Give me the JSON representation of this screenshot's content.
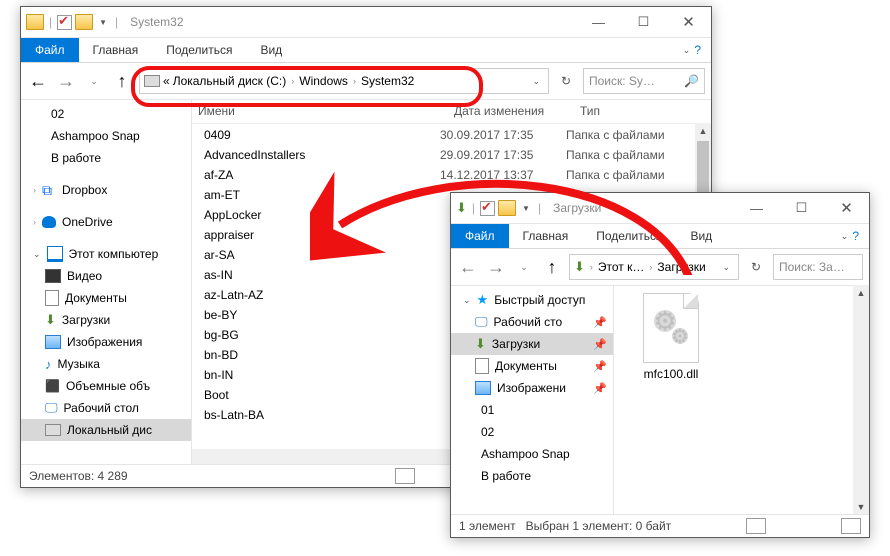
{
  "win1": {
    "title": "System32",
    "tabs": {
      "file": "Файл",
      "home": "Главная",
      "share": "Поделиться",
      "view": "Вид"
    },
    "breadcrumb": {
      "prefix": "«",
      "p1": "Локальный диск (C:)",
      "p2": "Windows",
      "p3": "System32"
    },
    "search_placeholder": "Поиск: Sy…",
    "columns": {
      "name": "Имени",
      "date": "Дата изменения",
      "type": "Тип"
    },
    "nav": {
      "i0": "02",
      "i1": "Ashampoo Snap",
      "i2": "В работе",
      "i3": "Dropbox",
      "i4": "OneDrive",
      "i5": "Этот компьютер",
      "i6": "Видео",
      "i7": "Документы",
      "i8": "Загрузки",
      "i9": "Изображения",
      "i10": "Музыка",
      "i11": "Объемные объ",
      "i12": "Рабочий стол",
      "i13": "Локальный дис"
    },
    "files": [
      {
        "name": "0409",
        "date": "30.09.2017 17:35",
        "type": "Папка с файлами"
      },
      {
        "name": "AdvancedInstallers",
        "date": "29.09.2017 17:35",
        "type": "Папка с файлами"
      },
      {
        "name": "af-ZA",
        "date": "14.12.2017 13:37",
        "type": "Папка с файлами"
      },
      {
        "name": "am-ET",
        "date": "",
        "type": ""
      },
      {
        "name": "AppLocker",
        "date": "",
        "type": ""
      },
      {
        "name": "appraiser",
        "date": "",
        "type": ""
      },
      {
        "name": "ar-SA",
        "date": "",
        "type": ""
      },
      {
        "name": "as-IN",
        "date": "",
        "type": ""
      },
      {
        "name": "az-Latn-AZ",
        "date": "",
        "type": ""
      },
      {
        "name": "be-BY",
        "date": "",
        "type": ""
      },
      {
        "name": "bg-BG",
        "date": "",
        "type": ""
      },
      {
        "name": "bn-BD",
        "date": "",
        "type": ""
      },
      {
        "name": "bn-IN",
        "date": "",
        "type": ""
      },
      {
        "name": "Boot",
        "date": "",
        "type": ""
      },
      {
        "name": "bs-Latn-BA",
        "date": "",
        "type": ""
      }
    ],
    "status": "Элементов: 4 289"
  },
  "win2": {
    "title": "Загрузки",
    "tabs": {
      "file": "Файл",
      "home": "Главная",
      "share": "Поделиться",
      "view": "Вид"
    },
    "breadcrumb": {
      "p1": "Этот к…",
      "p2": "Загрузки"
    },
    "search_placeholder": "Поиск: За…",
    "nav": {
      "i0": "Быстрый доступ",
      "i1": "Рабочий сто",
      "i2": "Загрузки",
      "i3": "Документы",
      "i4": "Изображени",
      "i5": "01",
      "i6": "02",
      "i7": "Ashampoo Snap",
      "i8": "В работе"
    },
    "file": "mfc100.dll",
    "status_left": "1 элемент",
    "status_right": "Выбран 1 элемент: 0 байт"
  }
}
